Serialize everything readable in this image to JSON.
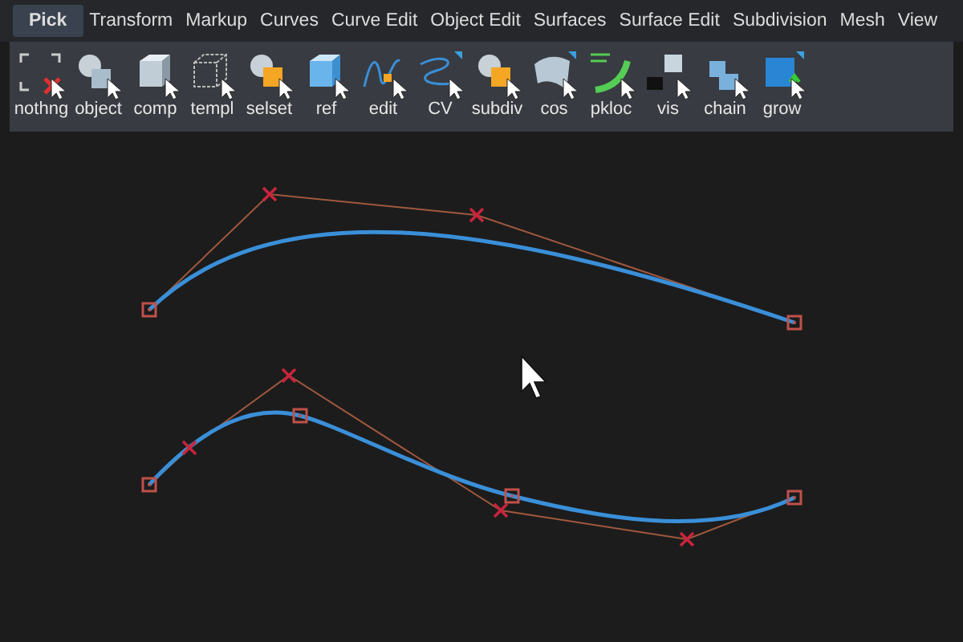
{
  "menu_tabs": [
    {
      "label": "Pick",
      "selected": true
    },
    {
      "label": "Transform",
      "selected": false
    },
    {
      "label": "Markup",
      "selected": false
    },
    {
      "label": "Curves",
      "selected": false
    },
    {
      "label": "Curve Edit",
      "selected": false
    },
    {
      "label": "Object Edit",
      "selected": false
    },
    {
      "label": "Surfaces",
      "selected": false
    },
    {
      "label": "Surface Edit",
      "selected": false
    },
    {
      "label": "Subdivision",
      "selected": false
    },
    {
      "label": "Mesh",
      "selected": false
    },
    {
      "label": "View",
      "selected": false
    }
  ],
  "shelf_tools": [
    {
      "label": "nothng",
      "kind": "corners"
    },
    {
      "label": "object",
      "kind": "sphere"
    },
    {
      "label": "comp",
      "kind": "cube"
    },
    {
      "label": "templ",
      "kind": "wire"
    },
    {
      "label": "selset",
      "kind": "orange"
    },
    {
      "label": "ref",
      "kind": "blue"
    },
    {
      "label": "edit",
      "kind": "curve"
    },
    {
      "label": "CV",
      "kind": "cv"
    },
    {
      "label": "subdiv",
      "kind": "orange"
    },
    {
      "label": "cos",
      "kind": "surface"
    },
    {
      "label": "pkloc",
      "kind": "pkloc"
    },
    {
      "label": "vis",
      "kind": "camera"
    },
    {
      "label": "chain",
      "kind": "chain"
    },
    {
      "label": "grow",
      "kind": "grow"
    }
  ]
}
